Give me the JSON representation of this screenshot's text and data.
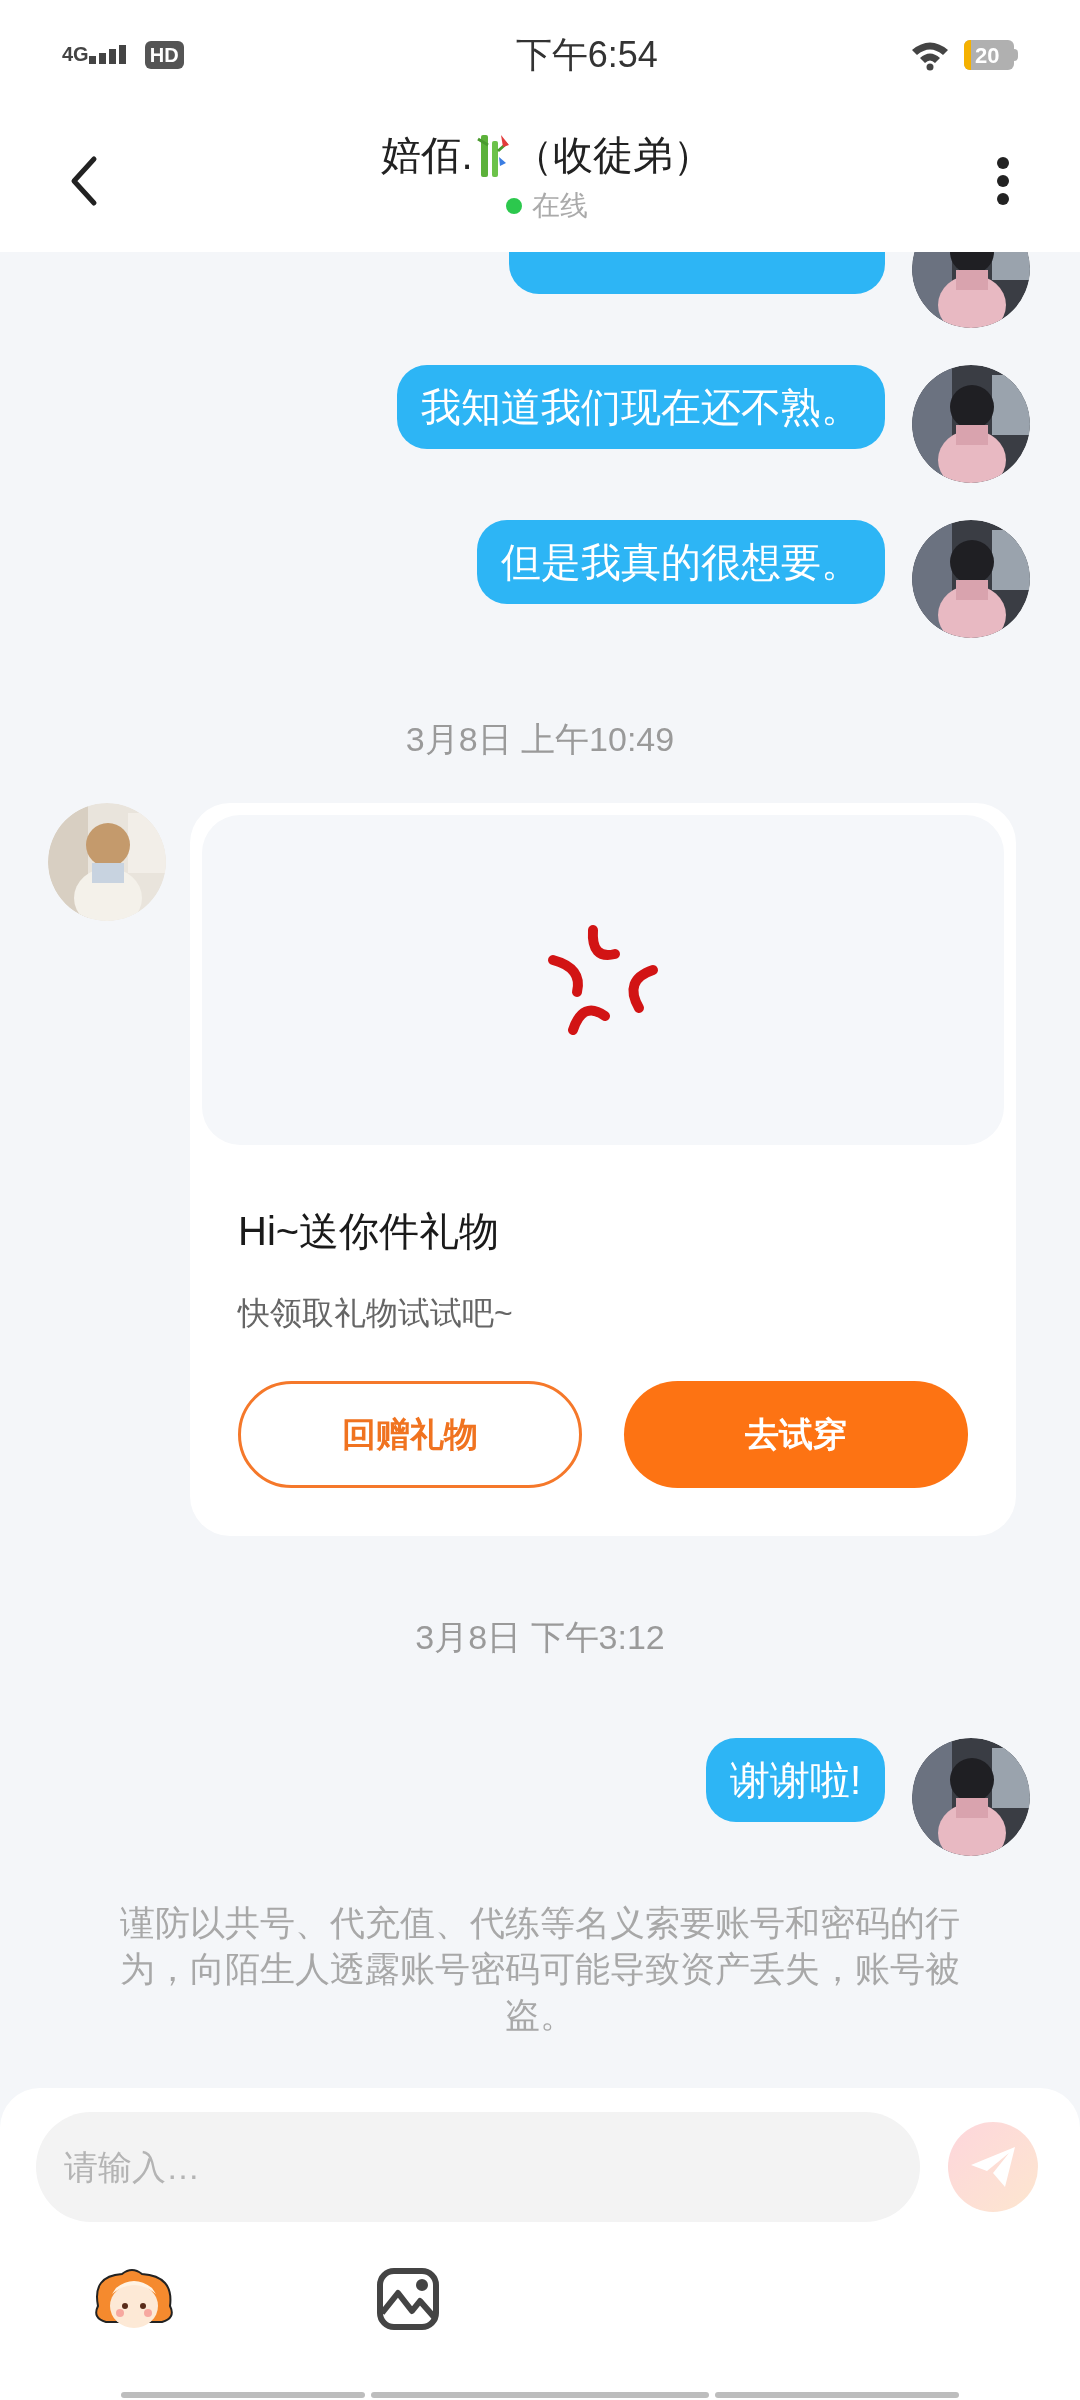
{
  "status_bar": {
    "network": "4G",
    "hd": "HD",
    "time": "下午6:54",
    "battery": "20"
  },
  "header": {
    "name": "婄佰.",
    "suffix": "（收徒弟）",
    "status": "在线",
    "online": true
  },
  "messages": [
    {
      "kind": "sent_hidden"
    },
    {
      "kind": "sent",
      "text": "我知道我们现在还不熟。"
    },
    {
      "kind": "sent",
      "text": "但是我真的很想要。"
    },
    {
      "kind": "time",
      "text": "3月8日 上午10:49"
    },
    {
      "kind": "gift",
      "title": "Hi~送你件礼物",
      "subtitle": "快领取礼物试试吧~",
      "buttons": [
        {
          "label": "回赠礼物",
          "kind": "outline"
        },
        {
          "label": "去试穿",
          "kind": "filled"
        }
      ]
    },
    {
      "kind": "time",
      "text": "3月8日 下午3:12"
    },
    {
      "kind": "sent",
      "text": "谢谢啦!"
    }
  ],
  "notice": "谨防以共号、代充值、代练等名义索要账号和密码的行为，向陌生人透露账号密码可能导致资产丢失，账号被盗。",
  "composer": {
    "placeholder": "请输入…"
  }
}
